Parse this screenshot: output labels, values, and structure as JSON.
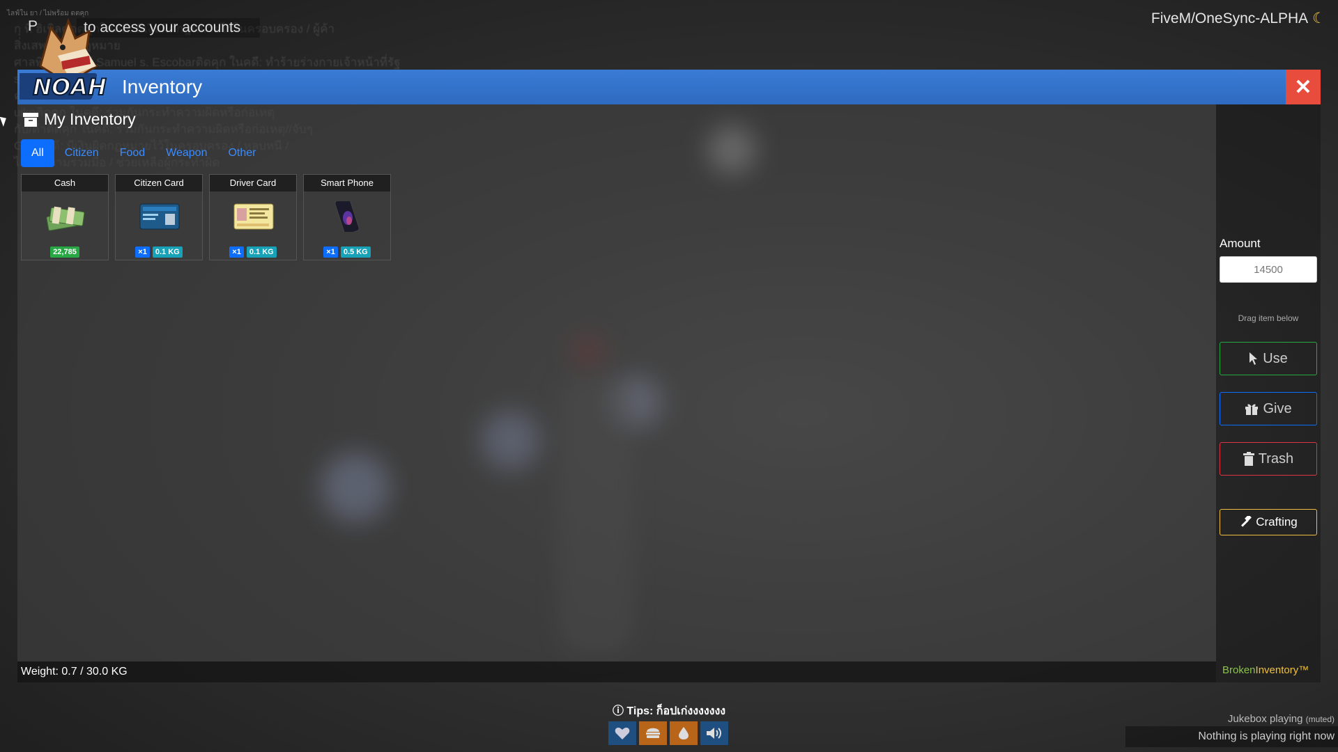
{
  "server": {
    "title": "FiveM/OneSync-ALPHA",
    "moon_icon": "moon-icon"
  },
  "overlay": {
    "access_prefix": "P",
    "access_text": "to access your accounts",
    "tiny_text": "ไลฟ์ใน ยา / ไม่พร้อม ดตคุก"
  },
  "background_chat": "กุ ทิ ฮิเบิลตดตคุกในคดี: มีเงินผิดกฎหมายไว้ในครอบครอง / ผู้ค้า\nสิ่งเสพติดผิดกฎหมาย\nศาลพิพากษาให้ Samuel s. Escobarติดคุก ในคดี: ทำร้ายร่างกายเจ้าหน้าที่รัฐ\nshilvich bouhติดคุก ในคดี: มีเงินผิดกฎหมายไว้ในครอบ\nครอง / ผู้ค้าสิ่งเสพติดผิดกฎหมาย / หลบหนี\nuikoติดคุก ในคดี: ร่วมกันกระทำความผิดหรือก่อเหตุ\nกับ/ต่ำติดคุก ในคดี: ร่วมกันกระทำความผิดหรือก่อเหตุ//จับๆ\nGr ในคดี: มีเงินผิดกฎหมายไว้ในครอบครอง / หลบหนี /\nไม่ให้ความร่วมมือ / ช่วยเหลือผู้กระทำผิด",
  "inventory": {
    "title": "Inventory",
    "close_label": "✕",
    "section_title": "My Inventory",
    "tabs": [
      {
        "label": "All",
        "active": true
      },
      {
        "label": "Citizen",
        "active": false
      },
      {
        "label": "Food",
        "active": false
      },
      {
        "label": "Weapon",
        "active": false
      },
      {
        "label": "Other",
        "active": false
      }
    ],
    "items": [
      {
        "name": "Cash",
        "icon": "cash-icon",
        "count": "22,785"
      },
      {
        "name": "Citizen Card",
        "icon": "citizen-card-icon",
        "qty": "×1",
        "weight": "0.1 KG"
      },
      {
        "name": "Driver Card",
        "icon": "driver-card-icon",
        "qty": "×1",
        "weight": "0.1 KG"
      },
      {
        "name": "Smart Phone",
        "icon": "smartphone-icon",
        "qty": "×1",
        "weight": "0.5 KG"
      }
    ],
    "weight_text": "Weight: 0.7 / 30.0 KG"
  },
  "side": {
    "amount_label": "Amount",
    "amount_value": "14500",
    "drag_hint": "Drag item below",
    "use_label": "Use",
    "give_label": "Give",
    "trash_label": "Trash",
    "crafting_label": "Crafting",
    "brand_a": "Broken",
    "brand_b": "Inventory™"
  },
  "hud": {
    "tips": "Tips: ก็อปเก่งงงงงงง",
    "icons": [
      "heart-icon",
      "burger-icon",
      "water-drop-icon",
      "speaker-icon"
    ]
  },
  "jukebox": {
    "label": "Jukebox playing",
    "muted": "(muted)",
    "status": "Nothing is playing right now"
  },
  "colors": {
    "header": "#3a7bd5",
    "close": "#e74c3c",
    "tab_active": "#0d6efd",
    "use": "#28a745",
    "give": "#0d6efd",
    "trash": "#dc3545",
    "craft": "#f0c040"
  }
}
